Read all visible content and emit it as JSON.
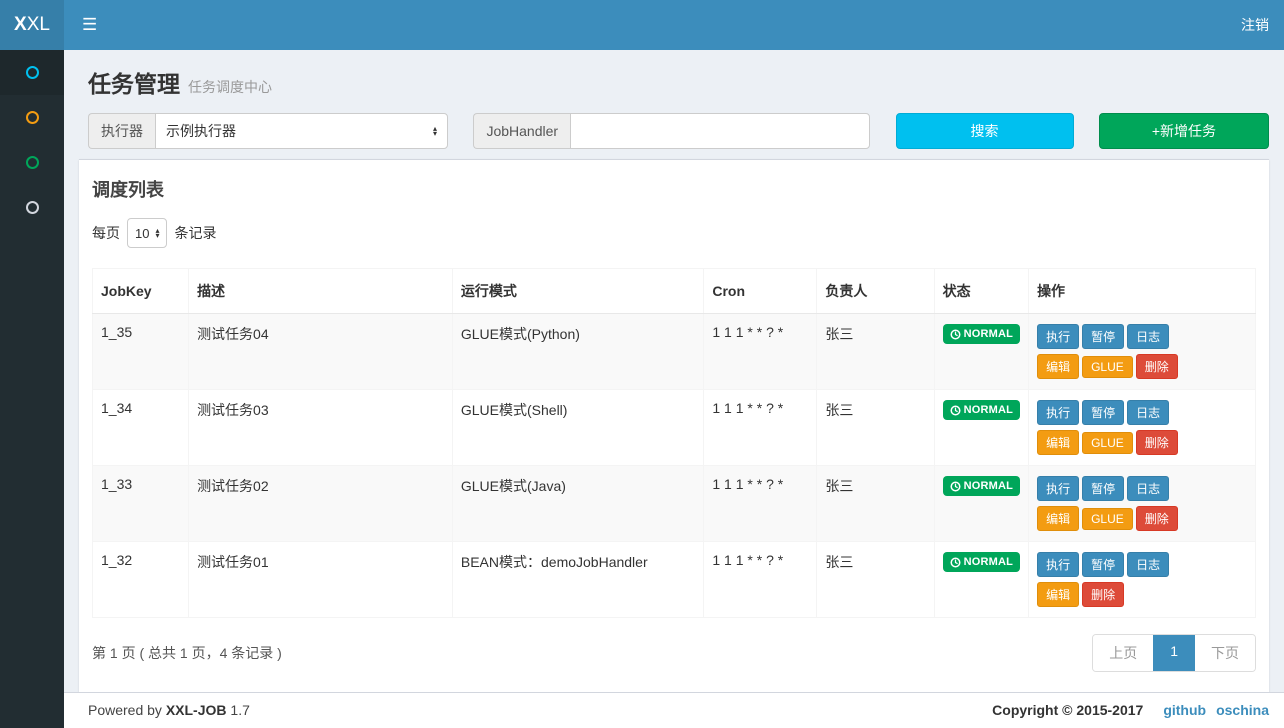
{
  "navbar": {
    "logo_bold": "X",
    "logo_rest": "XL",
    "menu_icon": "☰",
    "logout_label": "注销"
  },
  "sidebar": {
    "items": [
      {
        "id": "item-1",
        "icon": "circle-icon",
        "color": "#00c0ef",
        "active": true
      },
      {
        "id": "item-2",
        "icon": "circle-icon",
        "color": "#f39c12",
        "active": false
      },
      {
        "id": "item-3",
        "icon": "circle-icon",
        "color": "#00a65a",
        "active": false
      },
      {
        "id": "item-4",
        "icon": "circle-icon",
        "color": "#d2d6de",
        "active": false
      }
    ]
  },
  "page_header": {
    "title": "任务管理",
    "subtitle": "任务调度中心"
  },
  "filters": {
    "executor_label": "执行器",
    "executor_value": "示例执行器",
    "jobhandler_label": "JobHandler",
    "jobhandler_value": "",
    "search_button": "搜索",
    "add_button": "+新增任务"
  },
  "panel": {
    "title": "调度列表",
    "page_size_prefix": "每页",
    "page_size_value": "10",
    "page_size_suffix": "条记录"
  },
  "table": {
    "columns": [
      "JobKey",
      "描述",
      "运行模式",
      "Cron",
      "负责人",
      "状态",
      "操作"
    ],
    "rows": [
      {
        "jobkey": "1_35",
        "desc": "测试任务04",
        "mode": "GLUE模式(Python)",
        "cron": "1 1 1 * * ? *",
        "owner": "张三",
        "status": {
          "icon": "clock-icon",
          "label": "NORMAL",
          "color": "#00a65a"
        },
        "actions": [
          [
            {
              "label": "执行",
              "type": "primary"
            },
            {
              "label": "暂停",
              "type": "primary"
            },
            {
              "label": "日志",
              "type": "primary"
            }
          ],
          [
            {
              "label": "编辑",
              "type": "warning"
            },
            {
              "label": "GLUE",
              "type": "warning"
            },
            {
              "label": "删除",
              "type": "danger"
            }
          ]
        ]
      },
      {
        "jobkey": "1_34",
        "desc": "测试任务03",
        "mode": "GLUE模式(Shell)",
        "cron": "1 1 1 * * ? *",
        "owner": "张三",
        "status": {
          "icon": "clock-icon",
          "label": "NORMAL",
          "color": "#00a65a"
        },
        "actions": [
          [
            {
              "label": "执行",
              "type": "primary"
            },
            {
              "label": "暂停",
              "type": "primary"
            },
            {
              "label": "日志",
              "type": "primary"
            }
          ],
          [
            {
              "label": "编辑",
              "type": "warning"
            },
            {
              "label": "GLUE",
              "type": "warning"
            },
            {
              "label": "删除",
              "type": "danger"
            }
          ]
        ]
      },
      {
        "jobkey": "1_33",
        "desc": "测试任务02",
        "mode": "GLUE模式(Java)",
        "cron": "1 1 1 * * ? *",
        "owner": "张三",
        "status": {
          "icon": "clock-icon",
          "label": "NORMAL",
          "color": "#00a65a"
        },
        "actions": [
          [
            {
              "label": "执行",
              "type": "primary"
            },
            {
              "label": "暂停",
              "type": "primary"
            },
            {
              "label": "日志",
              "type": "primary"
            }
          ],
          [
            {
              "label": "编辑",
              "type": "warning"
            },
            {
              "label": "GLUE",
              "type": "warning"
            },
            {
              "label": "删除",
              "type": "danger"
            }
          ]
        ]
      },
      {
        "jobkey": "1_32",
        "desc": "测试任务01",
        "mode": "BEAN模式：demoJobHandler",
        "cron": "1 1 1 * * ? *",
        "owner": "张三",
        "status": {
          "icon": "clock-icon",
          "label": "NORMAL",
          "color": "#00a65a"
        },
        "actions": [
          [
            {
              "label": "执行",
              "type": "primary"
            },
            {
              "label": "暂停",
              "type": "primary"
            },
            {
              "label": "日志",
              "type": "primary"
            }
          ],
          [
            {
              "label": "编辑",
              "type": "warning"
            },
            {
              "label": "删除",
              "type": "danger"
            }
          ]
        ]
      }
    ]
  },
  "pagination": {
    "summary": "第 1 页 ( 总共 1 页，4 条记录 )",
    "prev_label": "上页",
    "current_page": "1",
    "next_label": "下页"
  },
  "footer": {
    "powered_prefix": "Powered by",
    "brand": "XXL-JOB",
    "version": "1.7",
    "copyright": "Copyright © 2015-2017",
    "links": [
      {
        "label": "github"
      },
      {
        "label": "oschina"
      }
    ]
  },
  "colors": {
    "navbar": "#3c8dbc",
    "logo_bg": "#367fa9",
    "sidebar_bg": "#222d32",
    "content_bg": "#ecf0f5",
    "primary": "#3c8dbc",
    "info": "#00c0ef",
    "success": "#00a65a",
    "warning": "#f39c12",
    "danger": "#dd4b39"
  }
}
